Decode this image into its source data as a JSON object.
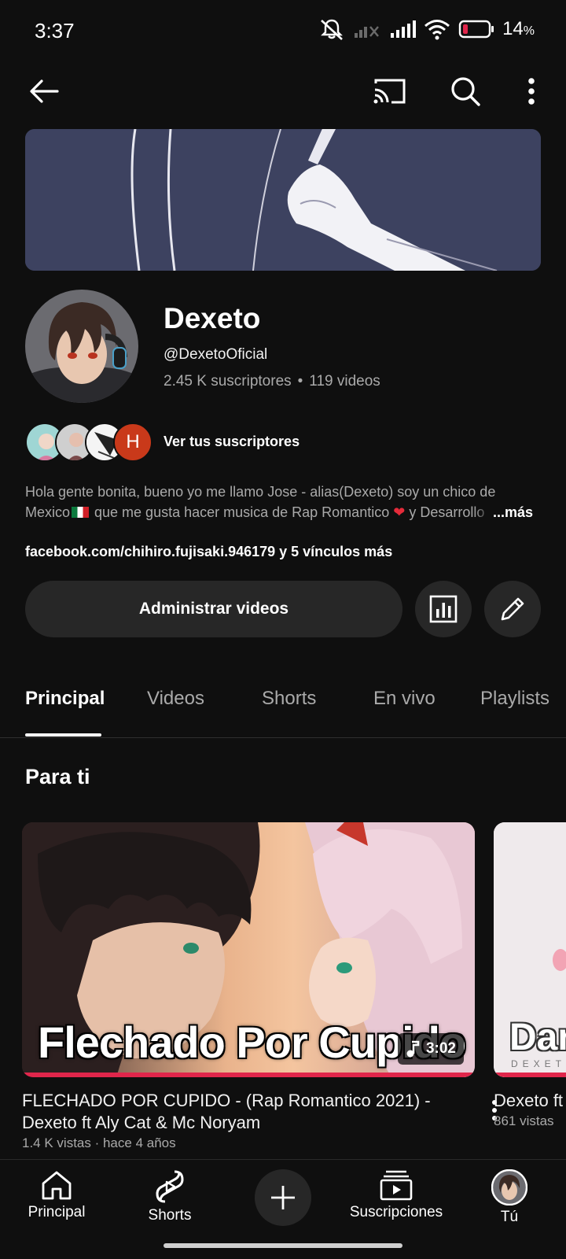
{
  "status_bar": {
    "time": "3:37",
    "battery": "14",
    "battery_unit": "%"
  },
  "app_bar": {
    "icons": [
      "back-arrow-icon",
      "cast-icon",
      "search-icon",
      "more-vert-icon"
    ]
  },
  "channel": {
    "name": "Dexeto",
    "handle": "@DexetoOficial",
    "subscribers": "2.45 K suscriptores",
    "separator": "•",
    "videos": "119 videos",
    "subscriber_initial": "H",
    "subscribers_link": "Ver tus suscriptores",
    "description_line1": "Hola gente bonita, bueno yo me llamo Jose - alias(Dexeto) soy un chico de",
    "description_line2_a": "Mexico",
    "description_line2_b": " que me gusta hacer musica de Rap Romantico ",
    "description_line2_c": " y Desarrollo",
    "description_more": "...más",
    "links": "facebook.com/chihiro.fujisaki.946179 y 5 vínculos más"
  },
  "actions": {
    "manage_videos": "Administrar videos",
    "icons": [
      "analytics-icon",
      "edit-pencil-icon"
    ]
  },
  "tabs": [
    "Principal",
    "Videos",
    "Shorts",
    "En vivo",
    "Playlists"
  ],
  "active_tab": "Principal",
  "section": {
    "title": "Para ti"
  },
  "videos": [
    {
      "thumb_text": "Flechado Por Cupido",
      "duration": "3:02",
      "title": "FLECHADO POR CUPIDO - (Rap Romantico 2021) - Dexeto ft Aly Cat & Mc Noryam",
      "meta": "1.4 K vistas · hace 4 años"
    },
    {
      "thumb_text": "Dar",
      "thumb_sub": "DEXETO",
      "title": "Dexeto ft Oportunidad",
      "meta": "861 vistas"
    }
  ],
  "bottom_nav": [
    {
      "label": "Principal",
      "icon": "home-icon"
    },
    {
      "label": "Shorts",
      "icon": "shorts-icon"
    },
    {
      "label": "",
      "icon": "create-plus-icon"
    },
    {
      "label": "Suscripciones",
      "icon": "subscriptions-icon"
    },
    {
      "label": "Tú",
      "icon": "profile-avatar-icon"
    }
  ],
  "colors": {
    "background": "#0f0f0f",
    "surface": "#272727",
    "secondary_text": "#aaaaaa",
    "accent_red": "#e0264b"
  }
}
